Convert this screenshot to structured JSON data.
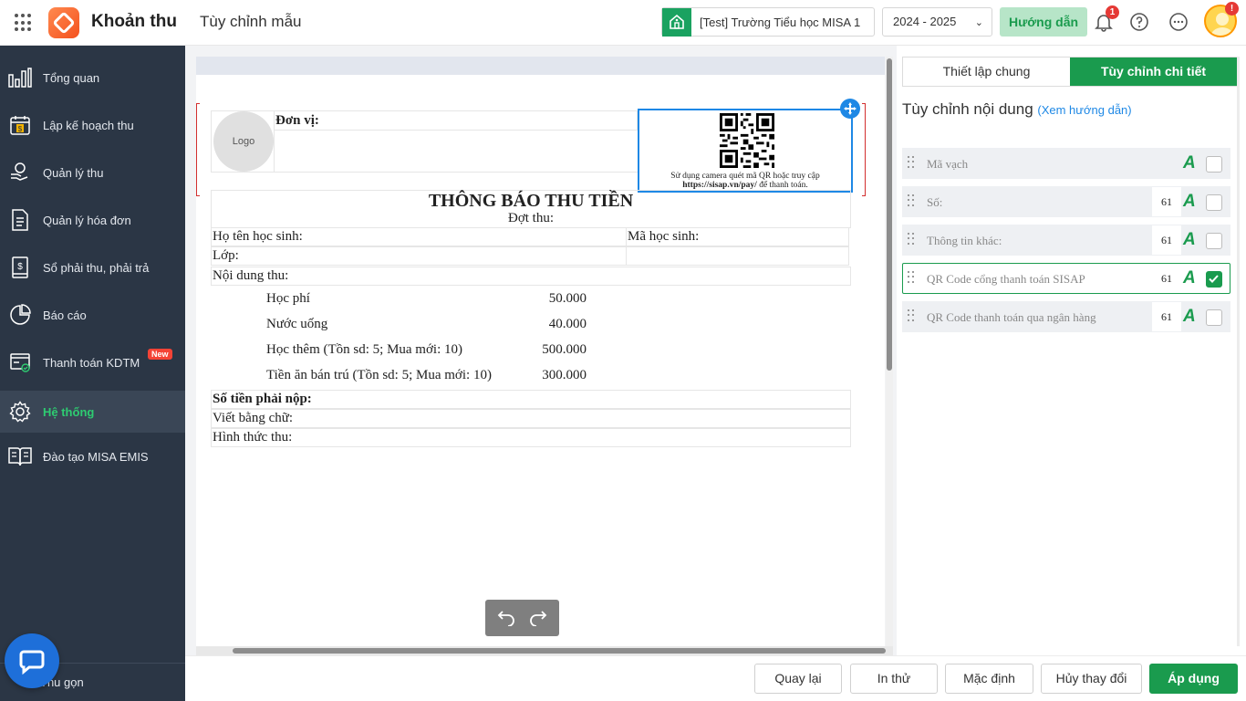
{
  "header": {
    "app_title": "Khoản thu",
    "page_title": "Tùy chỉnh mẫu",
    "school": "[Test] Trường Tiểu học MISA 1",
    "year": "2024 - 2025",
    "guide_label": "Hướng dẫn",
    "notification_count": "1",
    "alert_count": "!"
  },
  "sidebar": {
    "items": [
      {
        "label": "Tổng quan",
        "icon": "chart-bars-icon"
      },
      {
        "label": "Lập kế hoạch thu",
        "icon": "calendar-dollar-icon"
      },
      {
        "label": "Quản lý thu",
        "icon": "hand-coin-icon"
      },
      {
        "label": "Quản lý hóa đơn",
        "icon": "invoice-icon"
      },
      {
        "label": "Sổ phải thu, phải trả",
        "icon": "ledger-icon"
      },
      {
        "label": "Báo cáo",
        "icon": "pie-chart-icon"
      },
      {
        "label": "Thanh toán KDTM",
        "icon": "payment-icon",
        "badge": "New"
      },
      {
        "label": "Hệ thống",
        "icon": "gear-icon",
        "active": true
      },
      {
        "label": "Đào tạo MISA EMIS",
        "icon": "book-icon"
      }
    ],
    "collapse_label": "Thu gọn"
  },
  "document": {
    "logo_text": "Logo",
    "unit_label": "Đơn vị:",
    "qr_text_line1": "Sử dụng camera quét mã QR hoặc truy cập",
    "qr_text_url": "https://sisap.vn/pay/",
    "qr_text_tail": " để thanh toán.",
    "title": "THÔNG BÁO THU TIỀN",
    "subtitle": "Đợt thu:",
    "student_name_label": "Họ tên học sinh:",
    "student_code_label": "Mã học sinh:",
    "class_label": "Lớp:",
    "content_label": "Nội dung thu:",
    "fees": [
      {
        "name": "Học phí",
        "amount": "50.000"
      },
      {
        "name": "Nước uống",
        "amount": "40.000"
      },
      {
        "name": "Học thêm (Tồn sd: 5; Mua mới: 10)",
        "amount": "500.000"
      },
      {
        "name": "Tiền ăn bán trú (Tồn sd: 5; Mua mới: 10)",
        "amount": "300.000"
      }
    ],
    "total_label": "Số tiền phải nộp:",
    "in_words_label": "Viết bằng chữ:",
    "method_label": "Hình thức thu:"
  },
  "panel": {
    "tabs": [
      "Thiết lập chung",
      "Tùy chỉnh chi tiết"
    ],
    "heading": "Tùy chỉnh nội dung",
    "heading_link": "(Xem hướng dẫn)",
    "options": [
      {
        "label": "Mã vạch",
        "size": "",
        "checked": false
      },
      {
        "label": "Số:",
        "size": "61",
        "checked": false
      },
      {
        "label": "Thông tin khác:",
        "size": "61",
        "checked": false
      },
      {
        "label": "QR Code cổng thanh toán SISAP",
        "size": "61",
        "checked": true
      },
      {
        "label": "QR Code thanh toán qua ngân hàng",
        "size": "61",
        "checked": false
      }
    ]
  },
  "actions": {
    "back": "Quay lại",
    "print_test": "In thử",
    "default": "Mặc định",
    "discard": "Hủy thay đổi",
    "apply": "Áp dụng"
  },
  "colors": {
    "brand_green": "#1a9b4e",
    "sidebar_bg": "#2b3645",
    "accent_blue": "#1e88e5"
  }
}
